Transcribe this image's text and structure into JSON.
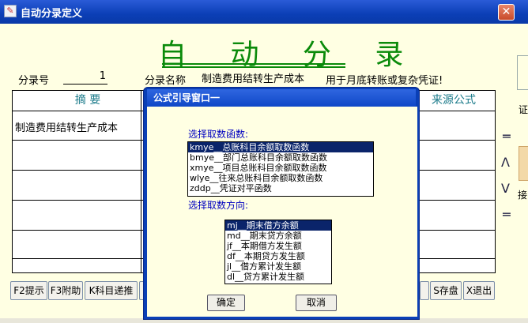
{
  "window": {
    "title": "自动分录定义",
    "close_label": "✕"
  },
  "page": {
    "big_title": "自 动 分 录"
  },
  "form": {
    "entry_no_label": "分录号",
    "entry_no_value": "1",
    "entry_name_label": "分录名称",
    "entry_name_value": "制造费用结转生产成本",
    "hint": "用于月底转账或复杂凭证!"
  },
  "grid": {
    "headers": {
      "summary": "摘  要",
      "source": "来源公式"
    },
    "rows": [
      {
        "summary": "制造费用结转生产成本"
      }
    ]
  },
  "side": {
    "text1": "证",
    "text2": "",
    "eq1": "═",
    "up": "Λ",
    "down": "V",
    "text3": "接",
    "eq2": "═"
  },
  "buttons": [
    {
      "label": "F2提示"
    },
    {
      "label": "F3附助"
    },
    {
      "label": "K科目递推"
    },
    {
      "label": "S存盘"
    },
    {
      "label": "X退出"
    }
  ],
  "dialog": {
    "title": "公式引导窗口一",
    "function_label": "选择取数函数:",
    "functions": [
      "kmye__总账科目余额取数函数",
      "bmye__部门总账科目余额取数函数",
      "xmye__项目总账科目余额取数函数",
      "wlye__往来总账科目余额取数函数",
      "zddp__凭证对平函数"
    ],
    "selected_function": 0,
    "direction_label": "选择取数方向:",
    "directions": [
      "mj__期末借方余额",
      "md__期末贷方余额",
      "jf__本期借方发生额",
      "df__本期贷方发生额",
      "jl__借方累计发生额",
      "dl__贷方累计发生额"
    ],
    "selected_direction": 0,
    "ok_label": "确定",
    "cancel_label": "取消"
  }
}
